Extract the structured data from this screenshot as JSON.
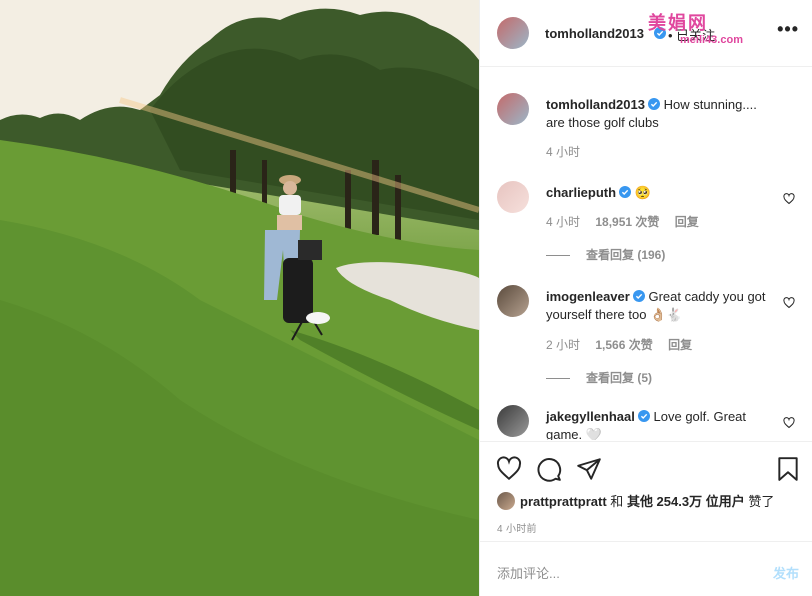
{
  "header": {
    "username": "tomholland2013",
    "follow_label": "• 已关注",
    "more_label": "•••",
    "watermark": "美娟网",
    "watermark_sub": "meili43.com"
  },
  "comments": [
    {
      "username": "tomholland2013",
      "text": "How stunning.... are those golf clubs",
      "time": "4 小时"
    },
    {
      "username": "charlieputh",
      "text": "🥺",
      "time": "4 小时",
      "likes": "18,951 次赞",
      "reply": "回复",
      "view_replies": "查看回复 (196)"
    },
    {
      "username": "imogenleaver",
      "text": "Great caddy you got yourself there too 👌🏼🐇",
      "time": "2 小时",
      "likes": "1,566 次赞",
      "reply": "回复",
      "view_replies": "查看回复 (5)"
    },
    {
      "username": "jakegyllenhaal",
      "text": "Love golf. Great game. 🤍"
    }
  ],
  "likes": {
    "user": "prattprattpratt",
    "and": "和",
    "others": "其他 254.3万 位用户",
    "suffix": "赞了"
  },
  "post_time": "4 小时前",
  "add_comment": {
    "placeholder": "添加评论...",
    "post_label": "发布"
  },
  "colors": {
    "verified": "#3897f0",
    "link_disabled": "#b2dffc",
    "secondary_text": "#8e8e8e"
  }
}
